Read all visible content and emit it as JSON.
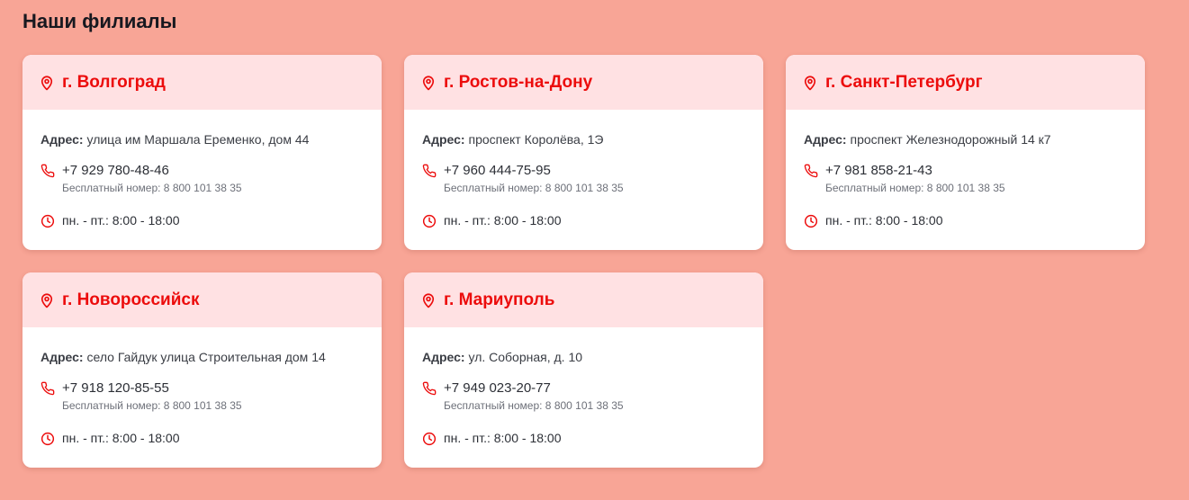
{
  "page": {
    "title": "Наши филиалы"
  },
  "colors": {
    "background": "#f8a596",
    "accent": "#ec0c0c",
    "card_header": "#ffe1e3",
    "card": "#ffffff"
  },
  "branches": [
    {
      "city": "г. Волгоград",
      "address_label": "Адрес:",
      "address": " улица им Маршала Еременко, дом 44",
      "phone": "+7 929 780-48-46",
      "free_number": "Бесплатный номер: 8 800 101 38 35",
      "hours": "пн. - пт.: 8:00 - 18:00",
      "icons": [
        "location-pin-icon",
        "phone-icon",
        "clock-icon"
      ]
    },
    {
      "city": "г. Ростов-на-Дону",
      "address_label": "Адрес:",
      "address": " проспект Королёва, 1Э",
      "phone": "+7 960 444-75-95",
      "free_number": "Бесплатный номер: 8 800 101 38 35",
      "hours": "пн. - пт.: 8:00 - 18:00",
      "icons": [
        "location-pin-icon",
        "phone-icon",
        "clock-icon"
      ]
    },
    {
      "city": "г. Санкт-Петербург",
      "address_label": "Адрес:",
      "address": " проспект Железнодорожный 14 к7",
      "phone": "+7 981 858-21-43",
      "free_number": "Бесплатный номер: 8 800 101 38 35",
      "hours": "пн. - пт.: 8:00 - 18:00",
      "icons": [
        "location-pin-icon",
        "phone-icon",
        "clock-icon"
      ]
    },
    {
      "city": "г. Новороссийск",
      "address_label": "Адрес:",
      "address": " село Гайдук улица Строительная дом 14",
      "phone": "+7 918 120-85-55",
      "free_number": "Бесплатный номер: 8 800 101 38 35",
      "hours": "пн. - пт.: 8:00 - 18:00",
      "icons": [
        "location-pin-icon",
        "phone-icon",
        "clock-icon"
      ]
    },
    {
      "city": "г. Мариуполь",
      "address_label": "Адрес:",
      "address": " ул. Соборная, д. 10",
      "phone": "+7 949 023-20-77",
      "free_number": "Бесплатный номер: 8 800 101 38 35",
      "hours": "пн. - пт.: 8:00 - 18:00",
      "icons": [
        "location-pin-icon",
        "phone-icon",
        "clock-icon"
      ]
    }
  ]
}
